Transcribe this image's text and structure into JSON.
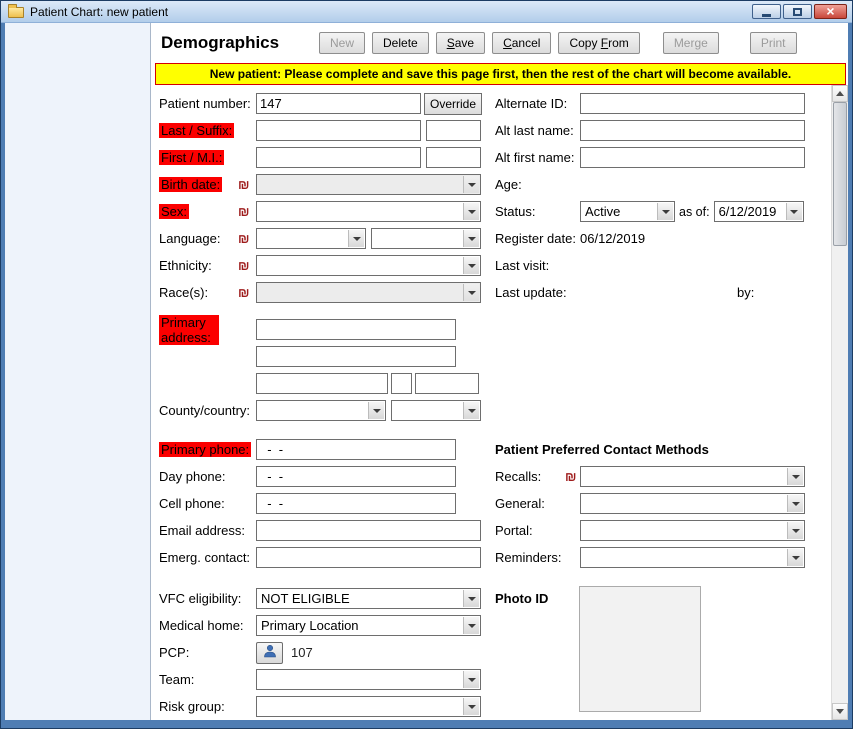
{
  "window": {
    "title": "Patient Chart: new patient"
  },
  "toolbar": {
    "title": "Demographics",
    "new_label": "New",
    "delete_label": "Delete",
    "save_u": "S",
    "save_rest": "ave",
    "cancel_u": "C",
    "cancel_rest": "ancel",
    "copy_pre": "Copy ",
    "copy_u": "F",
    "copy_rest": "rom",
    "merge_label": "Merge",
    "print_label": "Print"
  },
  "banner": {
    "text": "New patient: Please complete and save this page first, then the rest of the chart will become available."
  },
  "icons": {
    "flag": "₪"
  },
  "fields": {
    "patient_number": {
      "label": "Patient number:",
      "value": "147",
      "override_label": "Override"
    },
    "alternate_id": {
      "label": "Alternate ID:",
      "value": ""
    },
    "last_suffix": {
      "label": "Last / Suffix:",
      "last": "",
      "suffix": ""
    },
    "alt_last_name": {
      "label": "Alt last name:",
      "value": ""
    },
    "first_mi": {
      "label": "First / M.I.:",
      "first": "",
      "mi": ""
    },
    "alt_first_name": {
      "label": "Alt first name:",
      "value": ""
    },
    "birth_date": {
      "label": "Birth date:",
      "value": ""
    },
    "age": {
      "label": "Age:",
      "value": ""
    },
    "sex": {
      "label": "Sex:",
      "value": ""
    },
    "status": {
      "label": "Status:",
      "value": "Active",
      "as_of_label": "as of:",
      "as_of_date": "6/12/2019"
    },
    "language": {
      "label": "Language:",
      "value": "",
      "value2": ""
    },
    "register_date": {
      "label": "Register date:",
      "value": "06/12/2019"
    },
    "ethnicity": {
      "label": "Ethnicity:",
      "value": ""
    },
    "last_visit": {
      "label": "Last visit:",
      "value": ""
    },
    "races": {
      "label": "Race(s):",
      "value": ""
    },
    "last_update": {
      "label": "Last update:",
      "value": "",
      "by_label": "by:",
      "by_value": ""
    },
    "primary_address": {
      "label": "Primary address:",
      "line1": "",
      "line2": "",
      "city": "",
      "state": "",
      "zip": ""
    },
    "county_country": {
      "label": "County/country:",
      "county": "",
      "country": ""
    },
    "primary_phone": {
      "label": "Primary phone:",
      "value": "  -  -"
    },
    "contact_methods": {
      "heading": "Patient Preferred Contact Methods"
    },
    "day_phone": {
      "label": "Day phone:",
      "value": "  -  -"
    },
    "recalls": {
      "label": "Recalls:",
      "value": ""
    },
    "cell_phone": {
      "label": "Cell phone:",
      "value": "  -  -"
    },
    "general": {
      "label": "General:",
      "value": ""
    },
    "email": {
      "label": "Email address:",
      "value": ""
    },
    "portal": {
      "label": "Portal:",
      "value": ""
    },
    "emerg_contact": {
      "label": "Emerg. contact:",
      "value": ""
    },
    "reminders": {
      "label": "Reminders:",
      "value": ""
    },
    "vfc": {
      "label": "VFC eligibility:",
      "value": "NOT ELIGIBLE"
    },
    "photo_id": {
      "label": "Photo ID"
    },
    "medical_home": {
      "label": "Medical home:",
      "value": "Primary Location"
    },
    "pcp": {
      "label": "PCP:",
      "value": "107"
    },
    "team": {
      "label": "Team:",
      "value": ""
    },
    "risk_group": {
      "label": "Risk group:",
      "value": ""
    }
  }
}
